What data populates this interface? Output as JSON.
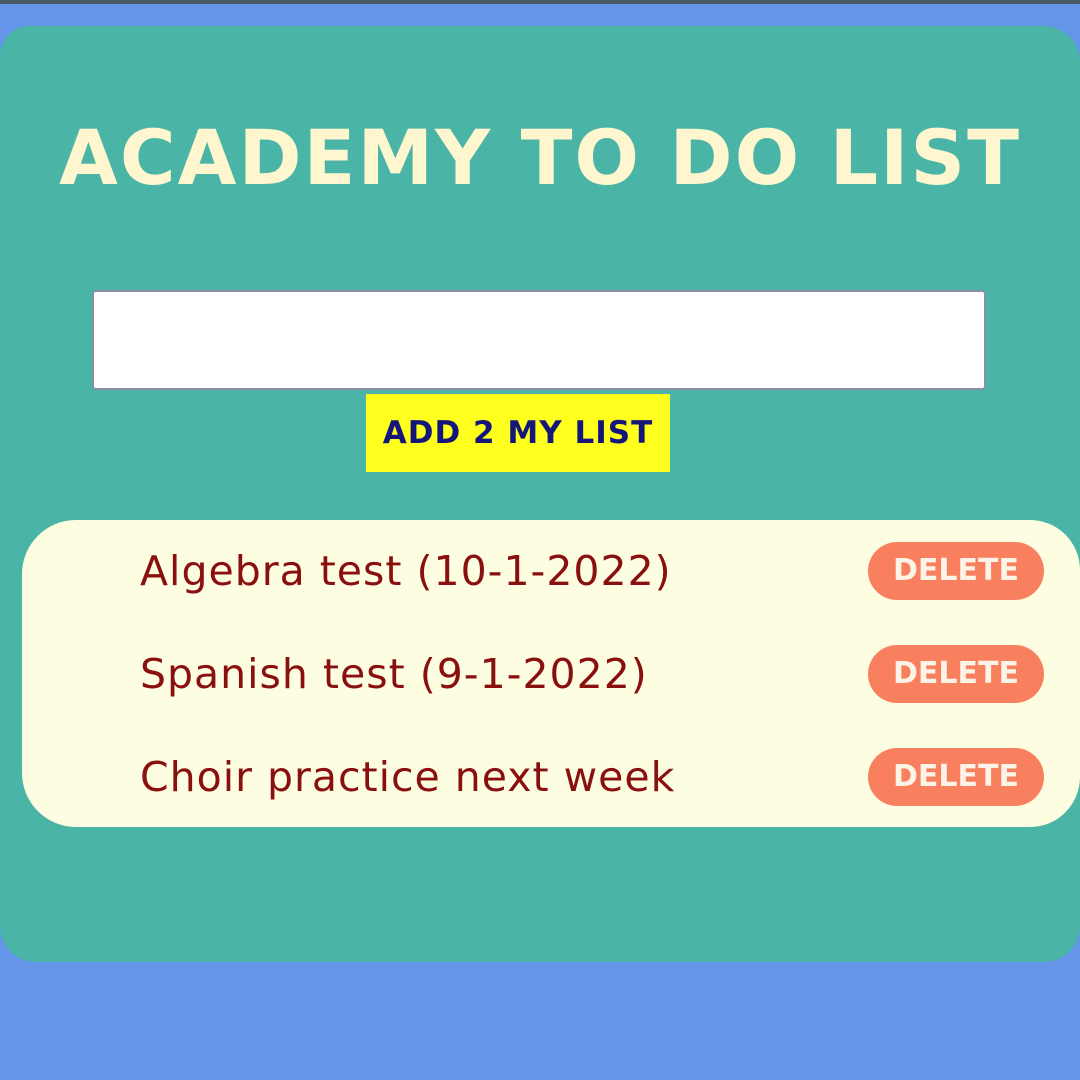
{
  "app": {
    "title": "ACADEMY TO DO LIST"
  },
  "input": {
    "value": "",
    "placeholder": ""
  },
  "add_button": {
    "label": "ADD 2 MY LIST"
  },
  "todos": [
    {
      "text": "Algebra test (10-1-2022)",
      "delete_label": "DELETE"
    },
    {
      "text": "Spanish test (9-1-2022)",
      "delete_label": "DELETE"
    },
    {
      "text": "Choir practice next week",
      "delete_label": "DELETE"
    }
  ],
  "colors": {
    "page_background": "#6495e8",
    "panel_background": "#4ab4a6",
    "title_text": "#fdf6cf",
    "add_button_background": "#ffff1e",
    "add_button_text": "#14167a",
    "list_background": "#fdfde2",
    "item_text": "#8a0f0f",
    "delete_button_background": "#f9805f",
    "delete_button_text": "#fdf3e6"
  }
}
